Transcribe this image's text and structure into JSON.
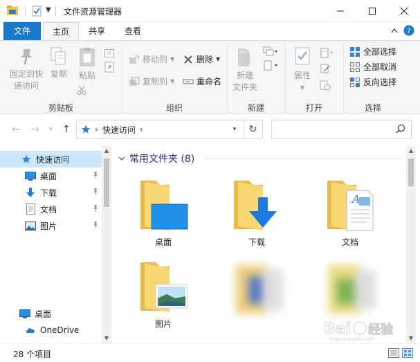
{
  "window": {
    "title": "文件资源管理器"
  },
  "ribbon_tabs": {
    "file": "文件",
    "home": "主页",
    "share": "共享",
    "view": "查看"
  },
  "ribbon": {
    "clipboard": {
      "pin_line1": "固定到快",
      "pin_line2": "速访问",
      "copy": "复制",
      "paste": "粘贴",
      "group_label": "剪贴板"
    },
    "organize": {
      "move_to": "移动到",
      "copy_to": "复制到",
      "delete": "删除",
      "rename": "重命名",
      "group_label": "组织"
    },
    "new": {
      "new_folder_line1": "新建",
      "new_folder_line2": "文件夹",
      "group_label": "新建"
    },
    "open": {
      "properties": "属性",
      "group_label": "打开"
    },
    "select": {
      "select_all": "全部选择",
      "select_none": "全部取消",
      "invert": "反向选择",
      "group_label": "选择"
    }
  },
  "address": {
    "crumb": "快速访问"
  },
  "nav_pane": {
    "items": [
      {
        "label": "快速访问",
        "icon": "star-icon"
      },
      {
        "label": "桌面",
        "icon": "desktop-icon"
      },
      {
        "label": "下载",
        "icon": "download-icon"
      },
      {
        "label": "文档",
        "icon": "document-icon"
      },
      {
        "label": "图片",
        "icon": "picture-icon"
      }
    ],
    "bottom_items": [
      {
        "label": "桌面",
        "icon": "desktop-icon"
      },
      {
        "label": "OneDrive",
        "icon": "cloud-icon"
      }
    ]
  },
  "content": {
    "section_title": "常用文件夹 (8)",
    "folders": [
      {
        "label": "桌面"
      },
      {
        "label": "下载"
      },
      {
        "label": "文档"
      },
      {
        "label": "图片"
      }
    ]
  },
  "status": {
    "count": "28 个项目"
  },
  "colors": {
    "accent": "#1979ca",
    "selection": "#cce8ff",
    "folder": "#f8d775",
    "folder_dark": "#e9b949",
    "header_text": "#1e3287"
  }
}
